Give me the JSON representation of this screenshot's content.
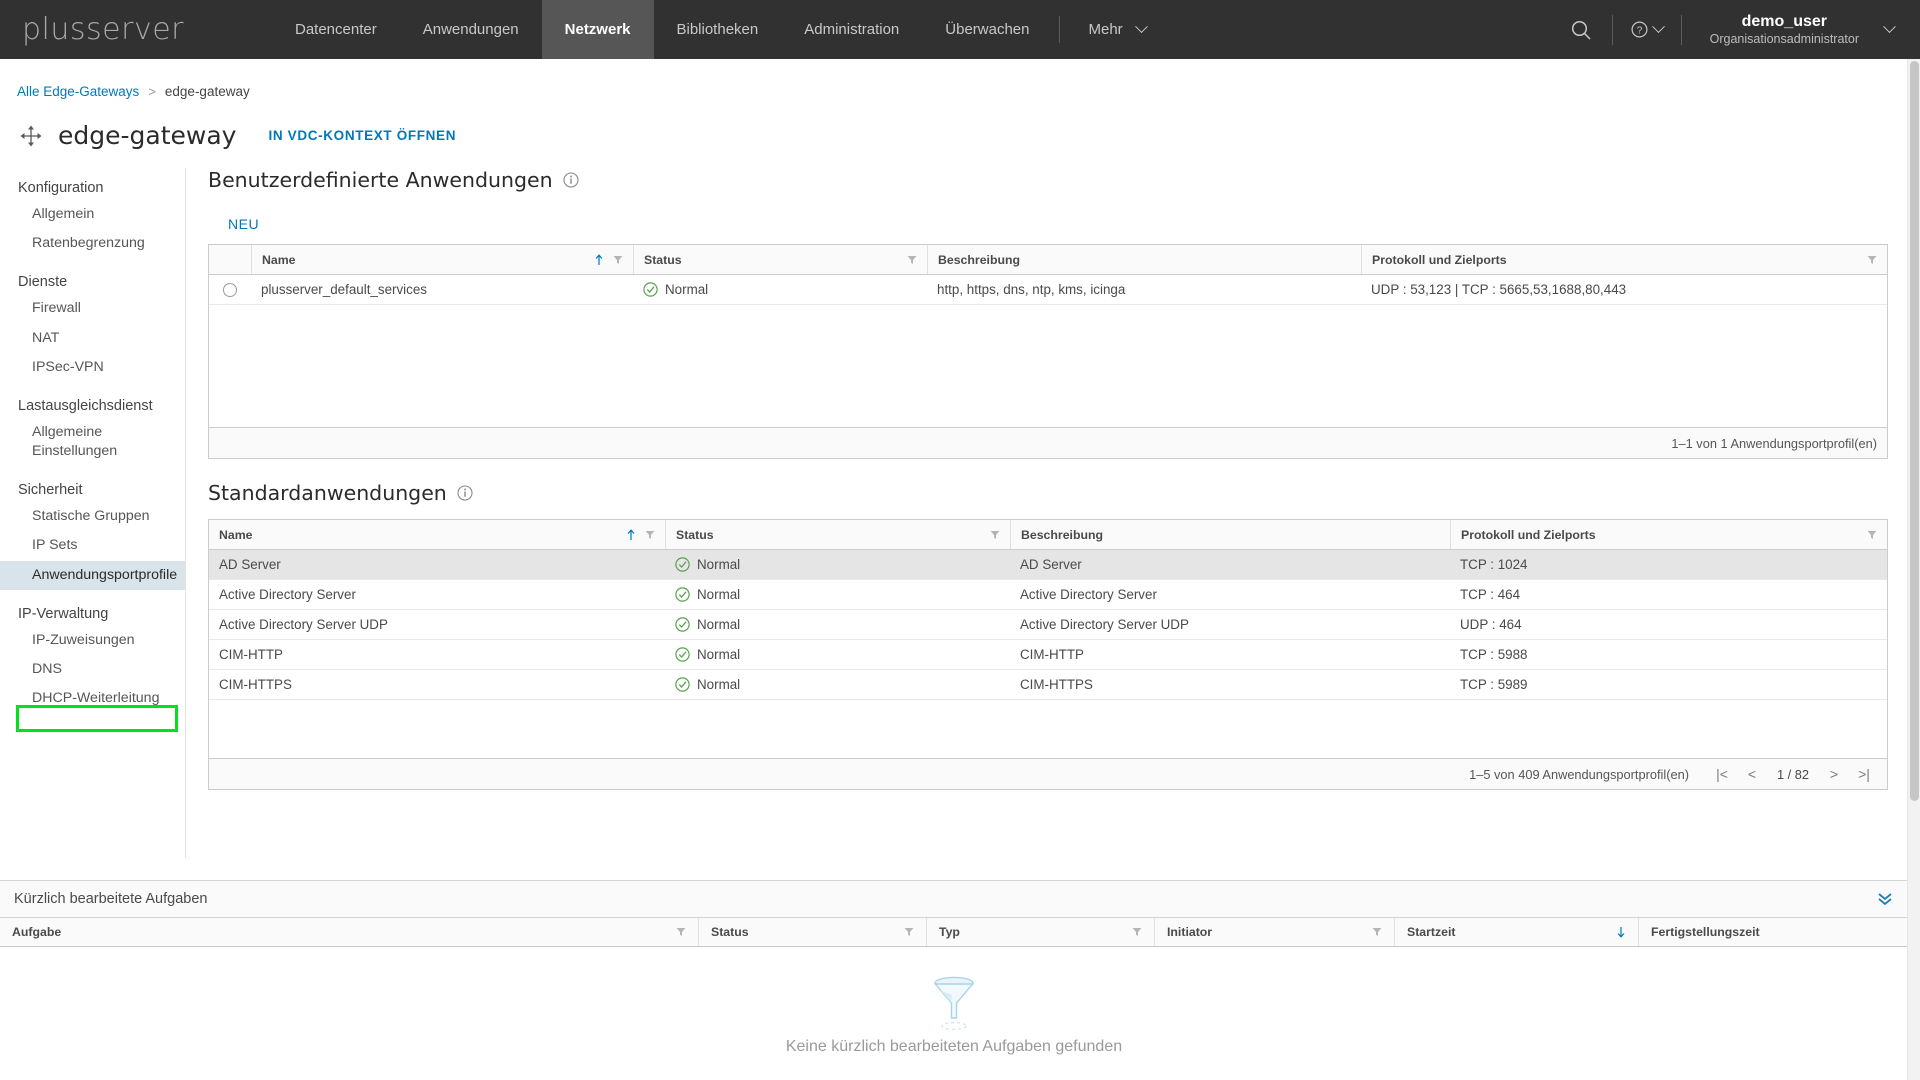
{
  "header": {
    "logo": "plusserver",
    "nav": [
      {
        "label": "Datencenter",
        "active": false
      },
      {
        "label": "Anwendungen",
        "active": false
      },
      {
        "label": "Netzwerk",
        "active": true
      },
      {
        "label": "Bibliotheken",
        "active": false
      },
      {
        "label": "Administration",
        "active": false
      },
      {
        "label": "Überwachen",
        "active": false
      }
    ],
    "more_label": "Mehr",
    "search_icon": "search-icon",
    "help_icon": "help-circle-icon",
    "user_name": "demo_user",
    "user_role": "Organisationsadministrator"
  },
  "breadcrumb": {
    "root": "Alle Edge-Gateways",
    "separator": ">",
    "current": "edge-gateway"
  },
  "page": {
    "title": "edge-gateway",
    "open_in_vdc": "IN VDC-KONTEXT ÖFFNEN"
  },
  "sidebar": {
    "groups": [
      {
        "label": "Konfiguration",
        "items": [
          {
            "label": "Allgemein",
            "selected": false
          },
          {
            "label": "Ratenbegrenzung",
            "selected": false
          }
        ]
      },
      {
        "label": "Dienste",
        "items": [
          {
            "label": "Firewall",
            "selected": false
          },
          {
            "label": "NAT",
            "selected": false
          },
          {
            "label": "IPSec-VPN",
            "selected": false
          }
        ]
      },
      {
        "label": "Lastausgleichsdienst",
        "items": [
          {
            "label": "Allgemeine Einstellungen",
            "selected": false,
            "two_line": true
          }
        ]
      },
      {
        "label": "Sicherheit",
        "items": [
          {
            "label": "Statische Gruppen",
            "selected": false
          },
          {
            "label": "IP Sets",
            "selected": false
          },
          {
            "label": "Anwendungsportprofile",
            "selected": true
          }
        ]
      },
      {
        "label": "IP-Verwaltung",
        "items": [
          {
            "label": "IP-Zuweisungen",
            "selected": false
          },
          {
            "label": "DNS",
            "selected": false
          },
          {
            "label": "DHCP-Weiterleitung",
            "selected": false
          }
        ]
      }
    ]
  },
  "custom_apps": {
    "title": "Benutzerdefinierte Anwendungen",
    "new_button": "NEU",
    "columns": [
      "Name",
      "Status",
      "Beschreibung",
      "Protokoll und Zielports"
    ],
    "rows": [
      {
        "name": "plusserver_default_services",
        "status": "Normal",
        "description": "http, https, dns, ntp, kms, icinga",
        "ports": "UDP :  53,123 | TCP :  5665,53,1688,80,443"
      }
    ],
    "footer": "1–1 von 1 Anwendungsportprofil(en)"
  },
  "standard_apps": {
    "title": "Standardanwendungen",
    "columns": [
      "Name",
      "Status",
      "Beschreibung",
      "Protokoll und Zielports"
    ],
    "rows": [
      {
        "name": "AD Server",
        "status": "Normal",
        "description": "AD Server",
        "ports": "TCP :  1024",
        "selected": true
      },
      {
        "name": "Active Directory Server",
        "status": "Normal",
        "description": "Active Directory Server",
        "ports": "TCP :  464",
        "selected": false
      },
      {
        "name": "Active Directory Server UDP",
        "status": "Normal",
        "description": "Active Directory Server UDP",
        "ports": "UDP :  464",
        "selected": false
      },
      {
        "name": "CIM-HTTP",
        "status": "Normal",
        "description": "CIM-HTTP",
        "ports": "TCP :  5988",
        "selected": false
      },
      {
        "name": "CIM-HTTPS",
        "status": "Normal",
        "description": "CIM-HTTPS",
        "ports": "TCP :  5989",
        "selected": false
      }
    ],
    "footer": "1–5 von 409 Anwendungsportprofil(en)",
    "pager": {
      "first": "|<",
      "prev": "<",
      "page": "1 / 82",
      "next": ">",
      "last": ">|"
    }
  },
  "tasks": {
    "title": "Kürzlich bearbeitete Aufgaben",
    "columns": [
      "Aufgabe",
      "Status",
      "Typ",
      "Initiator",
      "Startzeit",
      "Fertigstellungszeit"
    ],
    "empty_message": "Keine kürzlich bearbeiteten Aufgaben gefunden"
  },
  "colors": {
    "accent": "#0079b8",
    "header_bg": "#313131",
    "nav_active_bg": "#565656",
    "status_green": "#5aa34f",
    "highlight_green": "#00e21c",
    "selected_row": "#e5e5e5"
  }
}
